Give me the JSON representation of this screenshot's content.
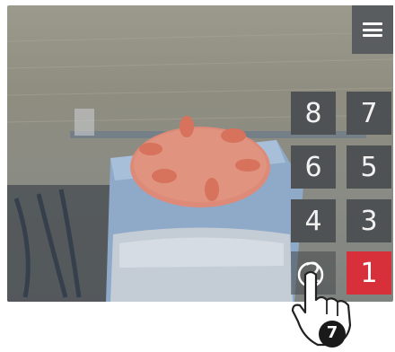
{
  "menu": {
    "icon": "hamburger-menu-icon"
  },
  "camera_buttons": [
    {
      "label": "8",
      "active": false
    },
    {
      "label": "7",
      "active": false
    },
    {
      "label": "6",
      "active": false
    },
    {
      "label": "5",
      "active": false
    },
    {
      "label": "4",
      "active": false
    },
    {
      "label": "3",
      "active": false
    },
    {
      "label": "2",
      "active": false
    },
    {
      "label": "1",
      "active": true
    }
  ],
  "colors": {
    "active": "#d8303a",
    "button": "#4f5254",
    "menu": "#5a5d60"
  },
  "step_badge": {
    "label": "7",
    "icon": "tap-hand-icon"
  }
}
